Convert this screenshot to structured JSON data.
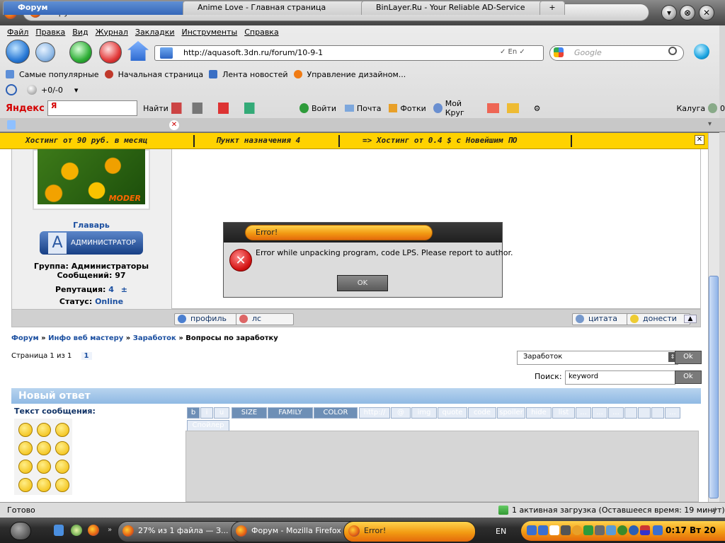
{
  "window": {
    "title": "Форум - Mozilla Firefox"
  },
  "menu": [
    "Файл",
    "Правка",
    "Вид",
    "Журнал",
    "Закладки",
    "Инструменты",
    "Справка"
  ],
  "nav": {
    "url": "http://aquasoft.3dn.ru/forum/10-9-1",
    "search_placeholder": "Google"
  },
  "bookmarks": [
    "Самые популярные",
    "Начальная страница",
    "Лента новостей",
    "Управление дизайном..."
  ],
  "rss_toolbar": {
    "counter": "+0/-0"
  },
  "yandex": {
    "logo": "Яндекс",
    "find": "Найти",
    "login": "Войти",
    "mail": "Почта",
    "photos": "Фотки",
    "circle": "Мой Круг",
    "city": "Калуга",
    "temp": "0"
  },
  "tabs": [
    "Форум",
    "Anime Love - Главная страница",
    "BinLayer.Ru - Your Reliable AD-Service"
  ],
  "ticker": [
    "Хостинг от 90 руб. в месяц",
    "Пункт назначения 4",
    "=> Хостинг от 0.4 $ с Новейшим ПО"
  ],
  "user": {
    "name": "Главарь",
    "rank": "АДМИНИСТРАТОР",
    "rank_letter": "A",
    "group": "Группа: Администраторы",
    "posts": "Сообщений: 97",
    "rep_label": "Репутация:",
    "rep_value": "4",
    "rep_ctrl": "±",
    "status_label": "Статус:",
    "status_value": "Online"
  },
  "post_buttons": {
    "profile": "профиль",
    "pm": "лс",
    "quote": "цитата",
    "report": "донести"
  },
  "breadcrumb": {
    "a": "Форум",
    "b": "Инфо веб мастеру",
    "c": "Заработок",
    "d": "Вопросы по заработку",
    "sep": "»"
  },
  "pager": {
    "label": "Страница 1 из 1",
    "page": "1"
  },
  "jump": {
    "selected": "Заработок",
    "ok": "Ok"
  },
  "search": {
    "label": "Поиск:",
    "value": "keyword",
    "ok": "Ok"
  },
  "reply": {
    "title": "Новый ответ",
    "msg_label": "Текст сообщения:",
    "toolbar": [
      "b",
      "i",
      "u",
      "SIZE",
      "FAMILY",
      "COLOR",
      "http://",
      "@",
      "img",
      "quote",
      "code",
      "spoiler",
      "hide",
      "list",
      "..."
    ],
    "spoiler": "Спойлер"
  },
  "dialog": {
    "title": "Error!",
    "message": "Error while unpacking program, code LPS. Please report to author.",
    "ok": "OK"
  },
  "status": {
    "left": "Готово",
    "download": "1 активная загрузка (Оставшееся время: 19 минут)"
  },
  "taskbar": {
    "tasks": [
      "27% из 1 файла — З...",
      "Форум - Mozilla Firefox",
      "Error!"
    ],
    "lang": "EN",
    "clock": "0:17 Вт 20"
  },
  "colors": {
    "ticker": "#ffd200",
    "accent": "#f29a12",
    "link": "#1b4fa0"
  }
}
